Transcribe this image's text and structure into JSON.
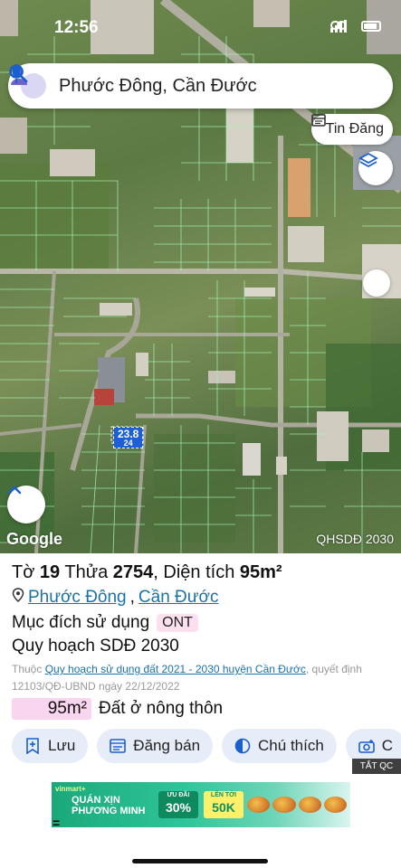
{
  "status": {
    "time": "12:56"
  },
  "search": {
    "text": "Phước Đông, Cần Đước"
  },
  "map": {
    "tin_dang_label": "Tin Đăng",
    "plot_label_line1": "23.8",
    "plot_label_line2": "24",
    "attribution": "Google",
    "layer_label": "QHSDĐ 2030"
  },
  "parcel": {
    "sheet_label": "Tờ",
    "sheet": "19",
    "plot_label": "Thửa",
    "plot": "2754",
    "area_label": ", Diện tích",
    "area": "95m²",
    "ward": "Phước Đông",
    "district": "Cần Đước",
    "purpose_label": "Mục đích sử dụng",
    "purpose_code": "ONT",
    "plan_label": "Quy hoạch SDĐ 2030",
    "ref_prefix": "Thuộc",
    "ref_link": "Quy hoạch sử dụng đất 2021 - 2030 huyện Cần Đước",
    "ref_suffix": ",",
    "ref_decision": "quyết định 12103/QĐ-UBND ngày 22/12/2022",
    "area_chip": "95m²",
    "area_type": "Đất ở nông thôn"
  },
  "actions": [
    {
      "label": "Lưu",
      "icon": "bookmark-plus-icon"
    },
    {
      "label": "Đăng bán",
      "icon": "listing-icon"
    },
    {
      "label": "Chú thích",
      "icon": "half-circle-icon"
    },
    {
      "label": "C",
      "icon": "camera-icon"
    }
  ],
  "ad": {
    "close_label": "TẮT QC",
    "brand": "vinmart+",
    "shop_line1": "QUÁN XỊN",
    "shop_line2": "PHƯƠNG MINH",
    "offer1_small": "ƯU ĐÃI",
    "offer1_big": "30%",
    "offer2_small": "LÊN TỚI",
    "offer2_big": "50K",
    "mark": "="
  },
  "colors": {
    "accent": "#1a73a8",
    "chip_bg": "#e6ecf8",
    "area_chip": "#fad5f0",
    "plot_highlight": "#1c5fd6"
  }
}
